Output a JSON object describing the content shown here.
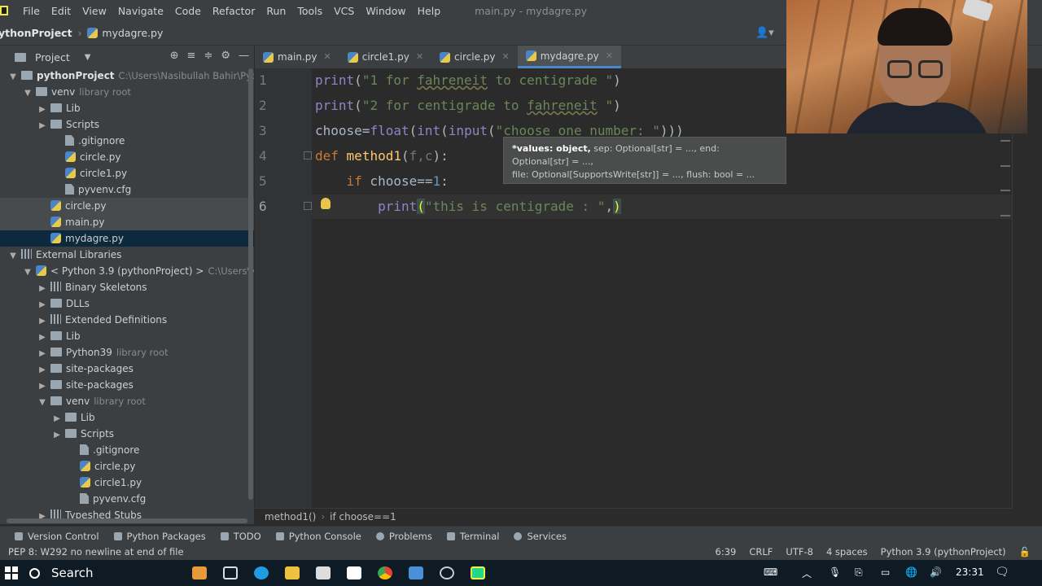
{
  "menu": [
    "File",
    "Edit",
    "View",
    "Navigate",
    "Code",
    "Refactor",
    "Run",
    "Tools",
    "VCS",
    "Window",
    "Help"
  ],
  "window_title": "main.py - mydagre.py",
  "breadcrumb": {
    "project": "ythonProject",
    "file": "mydagre.py"
  },
  "project_panel": {
    "label": "Project"
  },
  "tree": [
    {
      "text": "pythonProject",
      "dim": "C:\\Users\\Nasibullah Bahir\\Pycharm",
      "indent": 0,
      "arrow": "down",
      "icon": "folder",
      "bold": true
    },
    {
      "text": "venv",
      "dim": "library root",
      "indent": 1,
      "arrow": "down",
      "icon": "folder"
    },
    {
      "text": "Lib",
      "dim": "",
      "indent": 2,
      "arrow": "right",
      "icon": "folder"
    },
    {
      "text": "Scripts",
      "dim": "",
      "indent": 2,
      "arrow": "right",
      "icon": "folder"
    },
    {
      "text": ".gitignore",
      "dim": "",
      "indent": 3,
      "arrow": "",
      "icon": "file"
    },
    {
      "text": "circle.py",
      "dim": "",
      "indent": 3,
      "arrow": "",
      "icon": "py"
    },
    {
      "text": "circle1.py",
      "dim": "",
      "indent": 3,
      "arrow": "",
      "icon": "py"
    },
    {
      "text": "pyvenv.cfg",
      "dim": "",
      "indent": 3,
      "arrow": "",
      "icon": "file"
    },
    {
      "text": "circle.py",
      "dim": "",
      "indent": 2,
      "arrow": "",
      "icon": "py",
      "hl": true
    },
    {
      "text": "main.py",
      "dim": "",
      "indent": 2,
      "arrow": "",
      "icon": "py",
      "hl": true
    },
    {
      "text": "mydagre.py",
      "dim": "",
      "indent": 2,
      "arrow": "",
      "icon": "py",
      "sel": true
    },
    {
      "text": "External Libraries",
      "dim": "",
      "indent": 0,
      "arrow": "down",
      "icon": "lib"
    },
    {
      "text": "< Python 3.9 (pythonProject) >",
      "dim": "C:\\Users\\Nasib",
      "indent": 1,
      "arrow": "down",
      "icon": "py"
    },
    {
      "text": "Binary Skeletons",
      "dim": "",
      "indent": 2,
      "arrow": "right",
      "icon": "lib"
    },
    {
      "text": "DLLs",
      "dim": "",
      "indent": 2,
      "arrow": "right",
      "icon": "folder"
    },
    {
      "text": "Extended Definitions",
      "dim": "",
      "indent": 2,
      "arrow": "right",
      "icon": "lib"
    },
    {
      "text": "Lib",
      "dim": "",
      "indent": 2,
      "arrow": "right",
      "icon": "folder"
    },
    {
      "text": "Python39",
      "dim": "library root",
      "indent": 2,
      "arrow": "right",
      "icon": "folder"
    },
    {
      "text": "site-packages",
      "dim": "",
      "indent": 2,
      "arrow": "right",
      "icon": "folder"
    },
    {
      "text": "site-packages",
      "dim": "",
      "indent": 2,
      "arrow": "right",
      "icon": "folder"
    },
    {
      "text": "venv",
      "dim": "library root",
      "indent": 2,
      "arrow": "down",
      "icon": "folder"
    },
    {
      "text": "Lib",
      "dim": "",
      "indent": 3,
      "arrow": "right",
      "icon": "folder"
    },
    {
      "text": "Scripts",
      "dim": "",
      "indent": 3,
      "arrow": "right",
      "icon": "folder"
    },
    {
      "text": ".gitignore",
      "dim": "",
      "indent": 4,
      "arrow": "",
      "icon": "file"
    },
    {
      "text": "circle.py",
      "dim": "",
      "indent": 4,
      "arrow": "",
      "icon": "py"
    },
    {
      "text": "circle1.py",
      "dim": "",
      "indent": 4,
      "arrow": "",
      "icon": "py"
    },
    {
      "text": "pyvenv.cfg",
      "dim": "",
      "indent": 4,
      "arrow": "",
      "icon": "file"
    },
    {
      "text": "Typeshed Stubs",
      "dim": "",
      "indent": 2,
      "arrow": "right",
      "icon": "lib"
    }
  ],
  "tabs": [
    {
      "label": "main.py",
      "active": false
    },
    {
      "label": "circle1.py",
      "active": false
    },
    {
      "label": "circle.py",
      "active": false
    },
    {
      "label": "mydagre.py",
      "active": true
    }
  ],
  "line_numbers": [
    "1",
    "2",
    "3",
    "4",
    "5",
    "6"
  ],
  "tooltip": {
    "bold": "*values: object,",
    "line1_rest": " sep: Optional[str] = ..., end: Optional[str] = ...,",
    "line2": "file: Optional[SupportsWrite[str]] = ..., flush: bool = ..."
  },
  "code_crumbs": [
    "method1()",
    "if choose==1"
  ],
  "tool_windows": [
    "Version Control",
    "Python Packages",
    "TODO",
    "Python Console",
    "Problems",
    "Terminal",
    "Services"
  ],
  "status": {
    "message": "PEP 8: W292 no newline at end of file",
    "position": "6:39",
    "line_sep": "CRLF",
    "encoding": "UTF-8",
    "indent": "4 spaces",
    "interpreter": "Python 3.9 (pythonProject)"
  },
  "taskbar": {
    "search": "Search",
    "time": "23:31"
  }
}
